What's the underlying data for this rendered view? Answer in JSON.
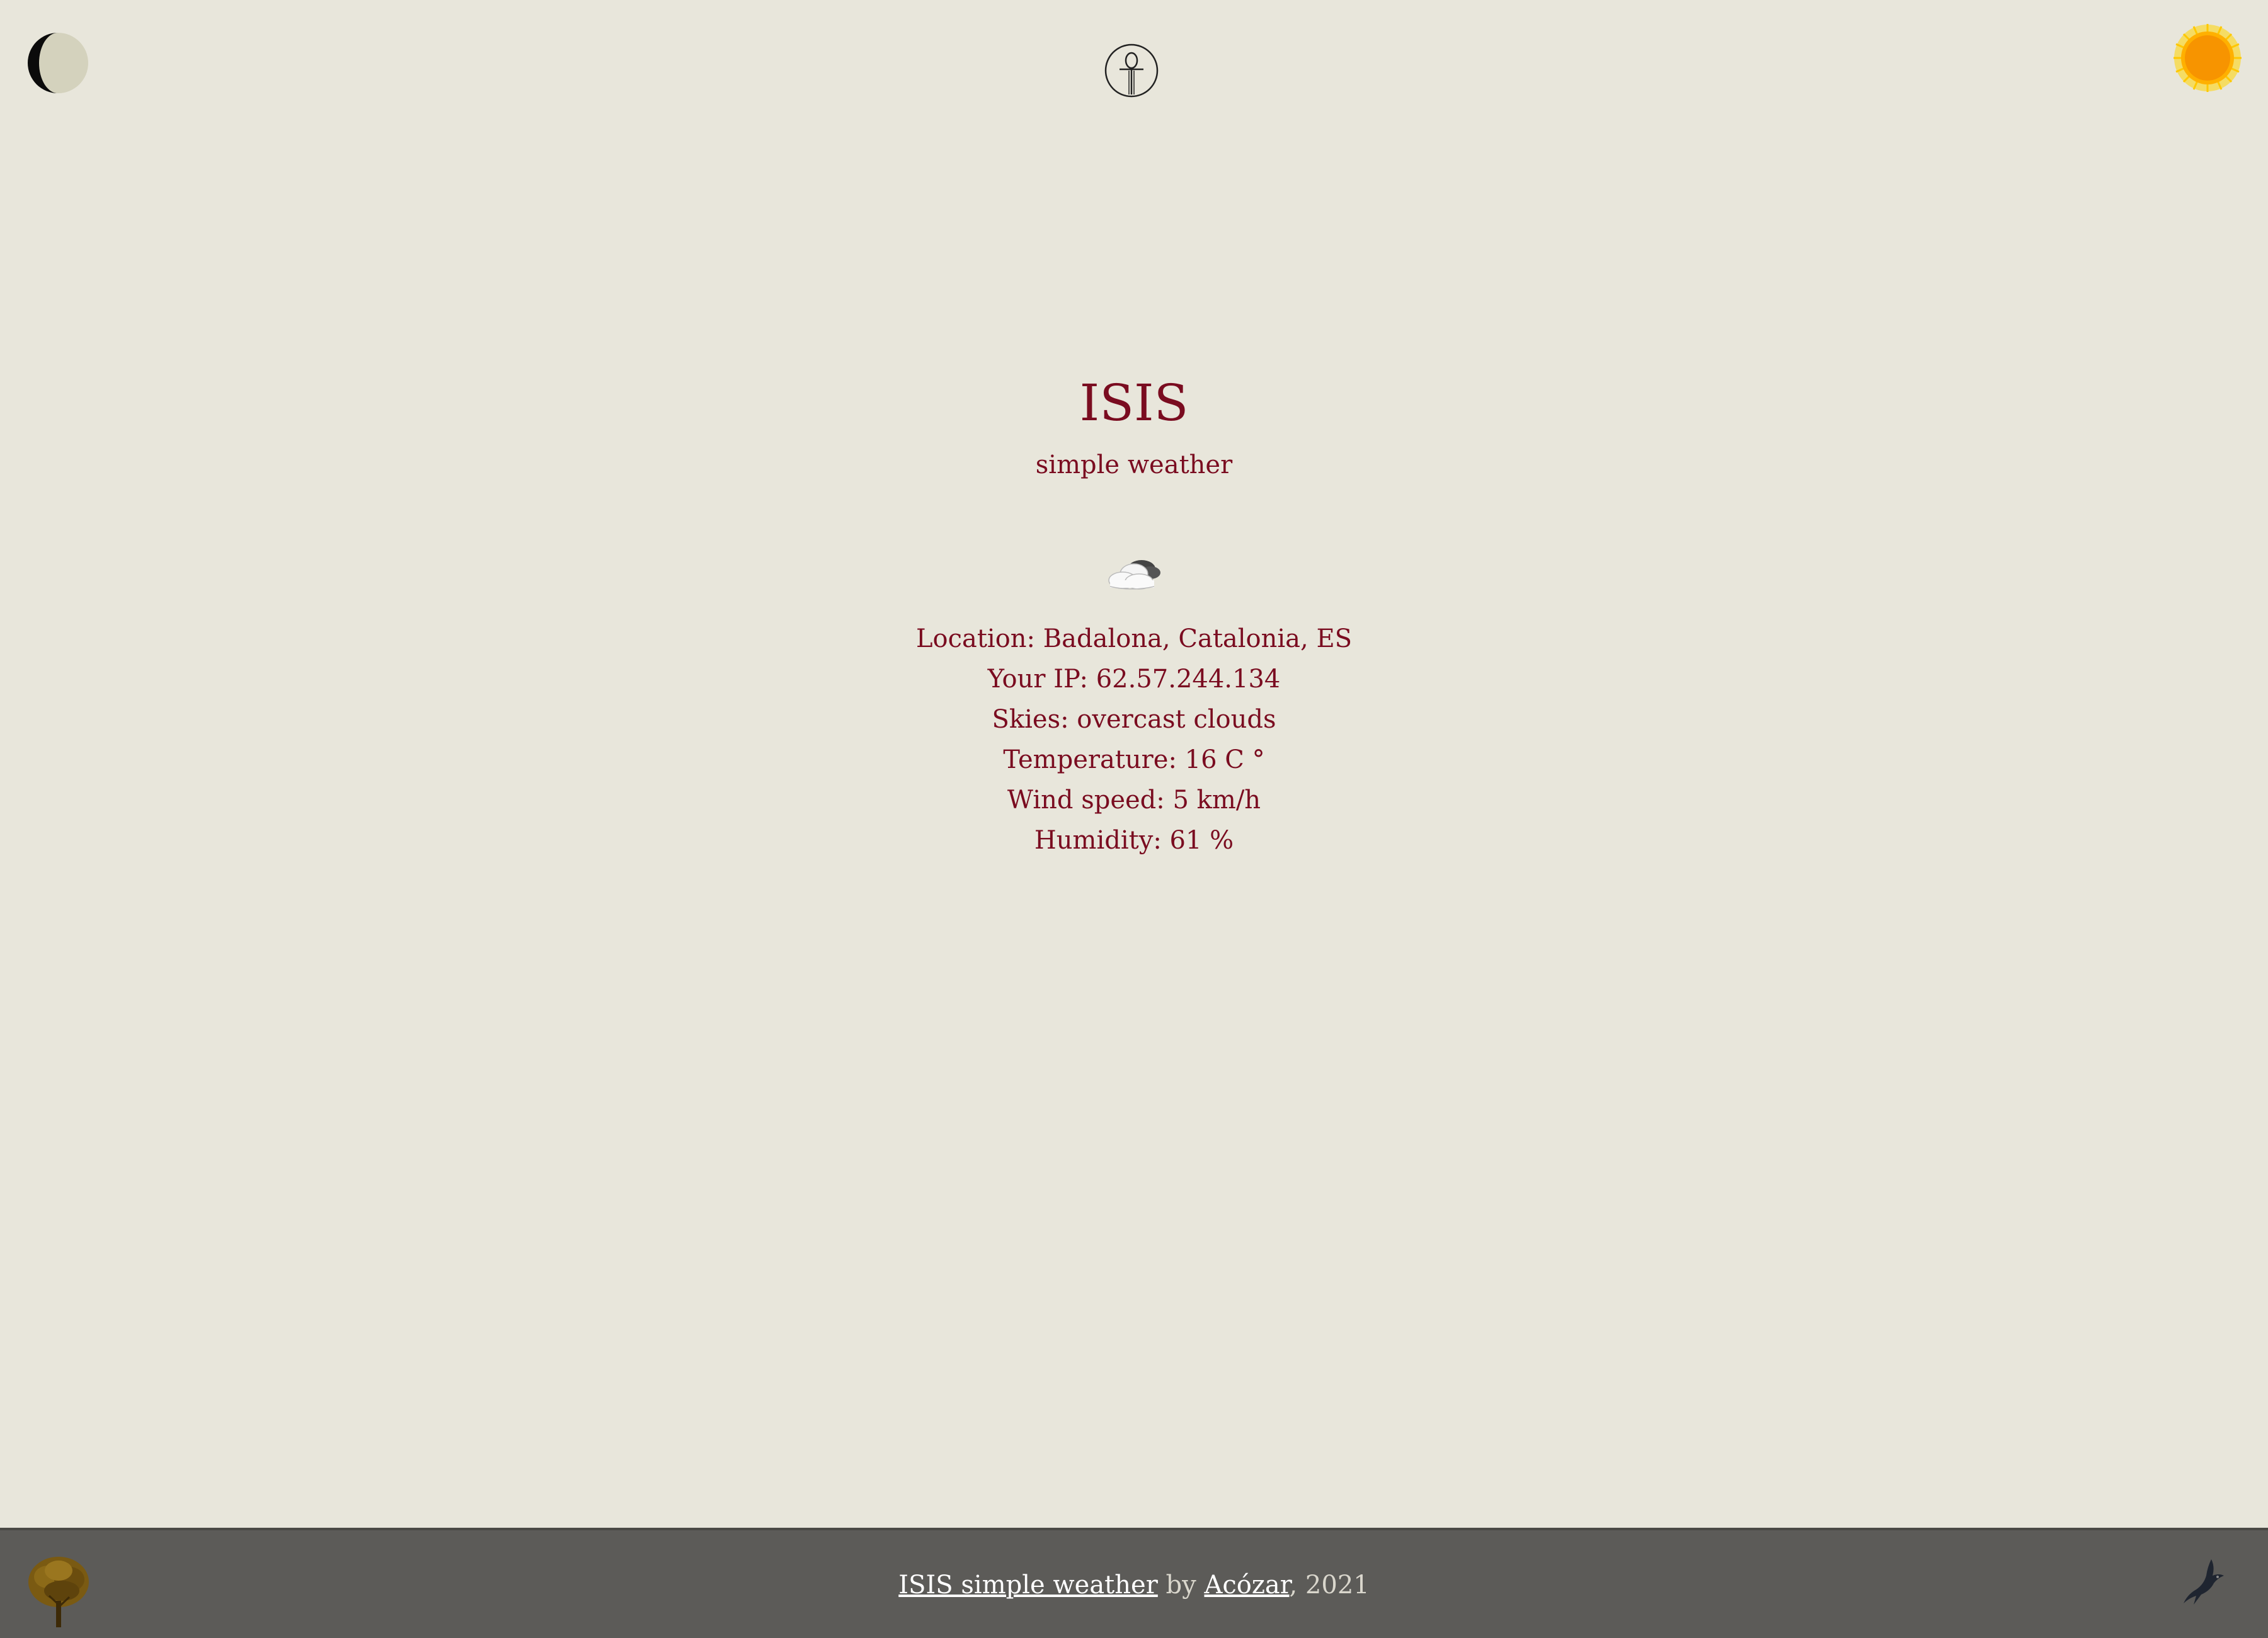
{
  "header": {
    "theme_toggle_icon": "half-moon-icon",
    "logo_icon": "ankh-icon",
    "sun_icon": "sun-icon"
  },
  "main": {
    "title": "ISIS",
    "subtitle": "simple weather",
    "weather_icon": "overcast-clouds-icon",
    "info": [
      "Location: Badalona, Catalonia, ES",
      "Your IP: 62.57.244.134",
      "Skies: overcast clouds",
      "Temperature: 16 C °",
      "Wind speed: 5 km/h",
      "Humidity: 61 %"
    ]
  },
  "footer": {
    "app_link": "ISIS simple weather",
    "by": " by ",
    "author_link": "Acózar",
    "year": ", 2021",
    "left_icon": "tree-icon",
    "right_icon": "bird-icon"
  },
  "colors": {
    "background": "#e8e6db",
    "text": "#7a0c20",
    "footer_bg": "#5c5b58",
    "sun": "#f7a400"
  }
}
